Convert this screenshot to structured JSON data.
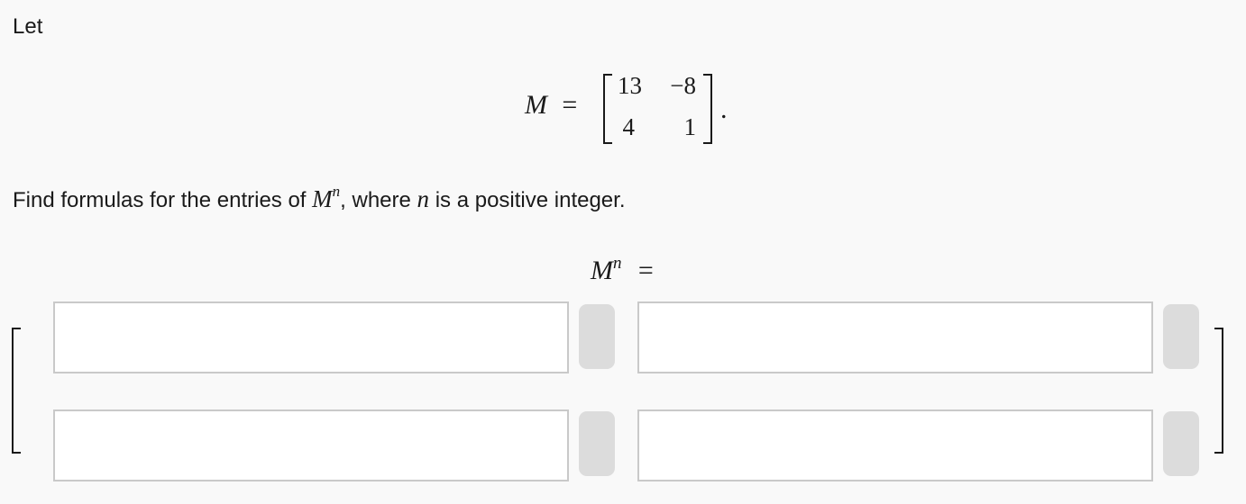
{
  "intro": "Let",
  "definition": {
    "lhs": "M",
    "equals": "=",
    "matrix": [
      [
        "13",
        "−8"
      ],
      [
        "4",
        "1"
      ]
    ],
    "period": "."
  },
  "question": {
    "part1": "Find formulas for the entries of ",
    "base": "M",
    "exponent": "n",
    "part2": ", where ",
    "variable": "n",
    "part3": " is a positive integer."
  },
  "answer_label": {
    "base": "M",
    "exponent": "n",
    "equals": "="
  },
  "answer_fields": [
    {
      "value": "",
      "placeholder": ""
    },
    {
      "value": "",
      "placeholder": ""
    },
    {
      "value": "",
      "placeholder": ""
    },
    {
      "value": "",
      "placeholder": ""
    }
  ]
}
